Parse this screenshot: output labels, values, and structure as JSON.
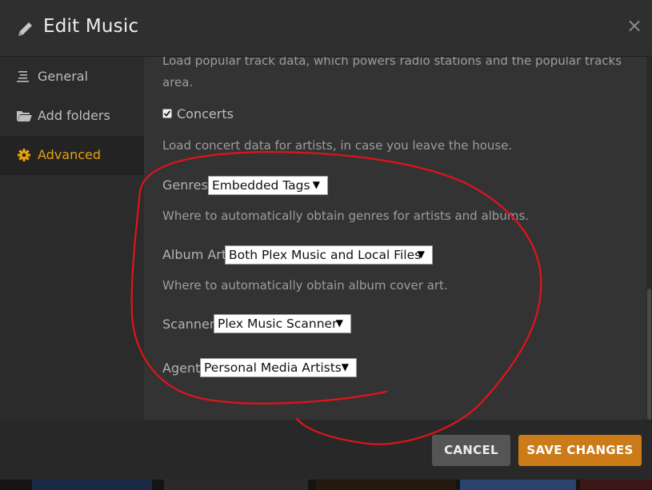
{
  "dialog": {
    "title": "Edit Music",
    "close_glyph": "×",
    "pencil_icon": "pencil-icon",
    "close_icon": "close-icon"
  },
  "sidebar": {
    "items": [
      {
        "label": "General",
        "icon": "list-icon",
        "active": false
      },
      {
        "label": "Add folders",
        "icon": "folder-icon",
        "active": false
      },
      {
        "label": "Advanced",
        "icon": "gear-icon",
        "active": true
      }
    ]
  },
  "content": {
    "clipped_text": "Load popular track data, which powers radio stations and the popular tracks area.",
    "concerts": {
      "label": "Concerts",
      "checked": true,
      "description": "Load concert data for artists, in case you leave the house."
    },
    "genres": {
      "label": "Genres",
      "value": "Embedded Tags",
      "description": "Where to automatically obtain genres for artists and albums."
    },
    "album_art": {
      "label": "Album Art",
      "value": "Both Plex Music and Local Files",
      "description": "Where to automatically obtain album cover art."
    },
    "scanner": {
      "label": "Scanner",
      "value": "Plex Music Scanner"
    },
    "agent": {
      "label": "Agent",
      "value": "Personal Media Artists"
    },
    "dropdown_arrow": "▼"
  },
  "footer": {
    "cancel_label": "CANCEL",
    "save_label": "SAVE CHANGES"
  },
  "colors": {
    "accent": "#e5a00d",
    "save_button": "#cc7b19",
    "cancel_button": "#555555",
    "annotation_circle": "#e0141b"
  }
}
